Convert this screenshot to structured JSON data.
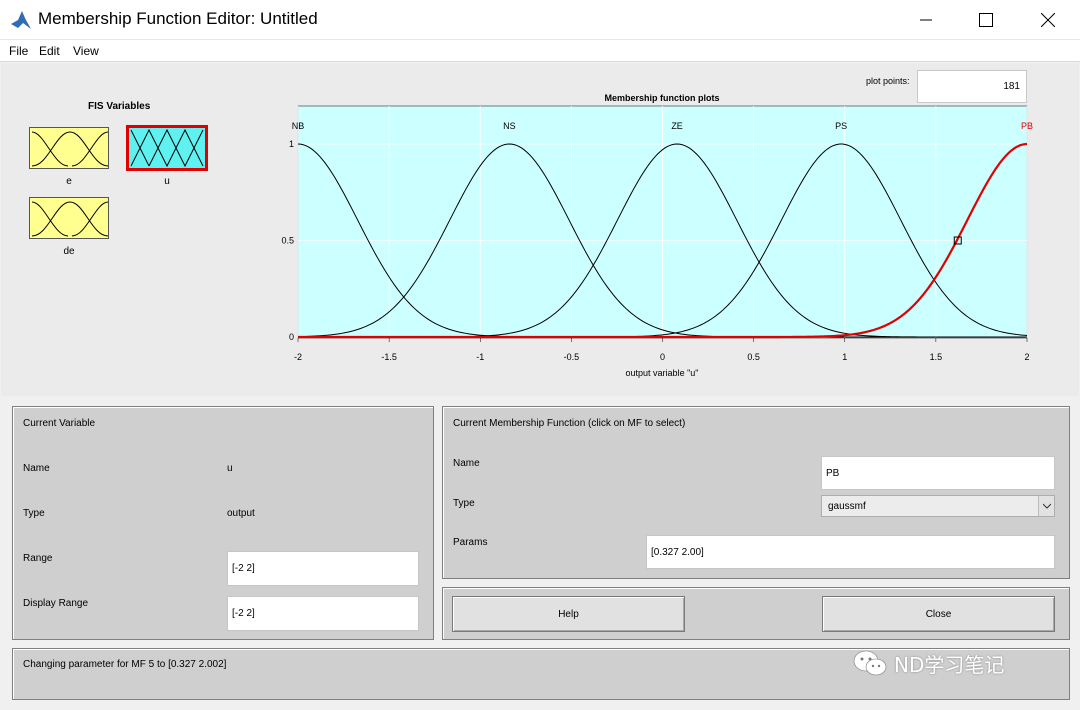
{
  "window": {
    "title": "Membership Function Editor: Untitled",
    "controls": [
      "minimize",
      "maximize",
      "close"
    ]
  },
  "menu": {
    "file": "File",
    "edit": "Edit",
    "view": "View"
  },
  "fis_variables": {
    "title": "FIS Variables",
    "inputs": [
      {
        "name": "e"
      },
      {
        "name": "de"
      }
    ],
    "output": {
      "name": "u",
      "selected": true
    }
  },
  "plot_points": {
    "label": "plot points:",
    "value": "181"
  },
  "plot": {
    "title": "Membership function plots",
    "xlabel": "output variable \"u\"",
    "xticks": [
      "-2",
      "-1.5",
      "-1",
      "-0.5",
      "0",
      "0.5",
      "1",
      "1.5",
      "2"
    ],
    "yticks": [
      "0",
      "0.5",
      "1"
    ],
    "background": "#ccffff",
    "selected_color": "#e00000"
  },
  "chart_data": {
    "type": "line",
    "title": "Membership function plots",
    "xlabel": "output variable \"u\"",
    "ylabel": "",
    "xlim": [
      -2,
      2
    ],
    "ylim": [
      0,
      1
    ],
    "function": "gaussmf",
    "series": [
      {
        "name": "NB",
        "sigma": 0.327,
        "center": -2.0,
        "selected": false
      },
      {
        "name": "NS",
        "sigma": 0.327,
        "center": -0.84,
        "selected": false
      },
      {
        "name": "ZE",
        "sigma": 0.327,
        "center": 0.08,
        "selected": false
      },
      {
        "name": "PS",
        "sigma": 0.327,
        "center": 0.98,
        "selected": false
      },
      {
        "name": "PB",
        "sigma": 0.327,
        "center": 2.0,
        "selected": true
      }
    ],
    "handle": {
      "x": 1.62,
      "y": 0.5
    }
  },
  "current_variable": {
    "title": "Current Variable",
    "name_label": "Name",
    "name_value": "u",
    "type_label": "Type",
    "type_value": "output",
    "range_label": "Range",
    "range_value": "[-2 2]",
    "display_range_label": "Display Range",
    "display_range_value": "[-2 2]"
  },
  "current_mf": {
    "title": "Current Membership Function (click on MF to select)",
    "name_label": "Name",
    "name_value": "PB",
    "type_label": "Type",
    "type_value": "gaussmf",
    "params_label": "Params",
    "params_value": "[0.327 2.00]"
  },
  "buttons": {
    "help": "Help",
    "close": "Close"
  },
  "status": {
    "text": "Changing parameter for MF 5 to  [0.327 2.002]"
  },
  "watermark": {
    "text": "ND学习笔记"
  }
}
